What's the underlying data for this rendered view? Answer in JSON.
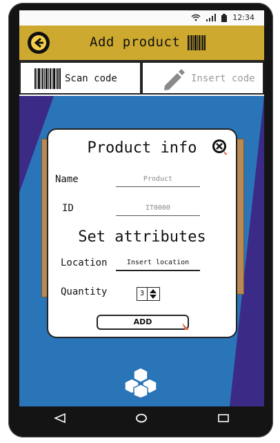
{
  "status_bar": {
    "time": "12:34",
    "icons": [
      "wifi-icon",
      "signal-icon",
      "battery-icon"
    ]
  },
  "app_bar": {
    "title": "Add product",
    "back_icon": "back-arrow-icon",
    "title_icon": "barcode-icon",
    "color": "#cda92f"
  },
  "tabs": [
    {
      "label": "Scan code",
      "icon": "barcode-icon",
      "active": true
    },
    {
      "label": "Insert code",
      "icon": "pencil-icon",
      "active": false
    }
  ],
  "dialog": {
    "title": "Product info",
    "close_icon": "close-icon",
    "fields": {
      "name": {
        "label": "Name",
        "placeholder": "Product"
      },
      "id": {
        "label": "ID",
        "placeholder": "IT0000"
      }
    },
    "attributes_title": "Set attributes",
    "location": {
      "label": "Location",
      "placeholder": "Insert location"
    },
    "quantity": {
      "label": "Quantity",
      "value": "3"
    },
    "add_label": "ADD"
  },
  "footer_icon": "cubes-icon",
  "nav_bar": {
    "icons": [
      "back-triangle-icon",
      "home-circle-icon",
      "recents-square-icon"
    ]
  },
  "colors": {
    "background_dark": "#3b2a86",
    "background_blue": "#2a74b8",
    "accent": "#cda92f"
  }
}
